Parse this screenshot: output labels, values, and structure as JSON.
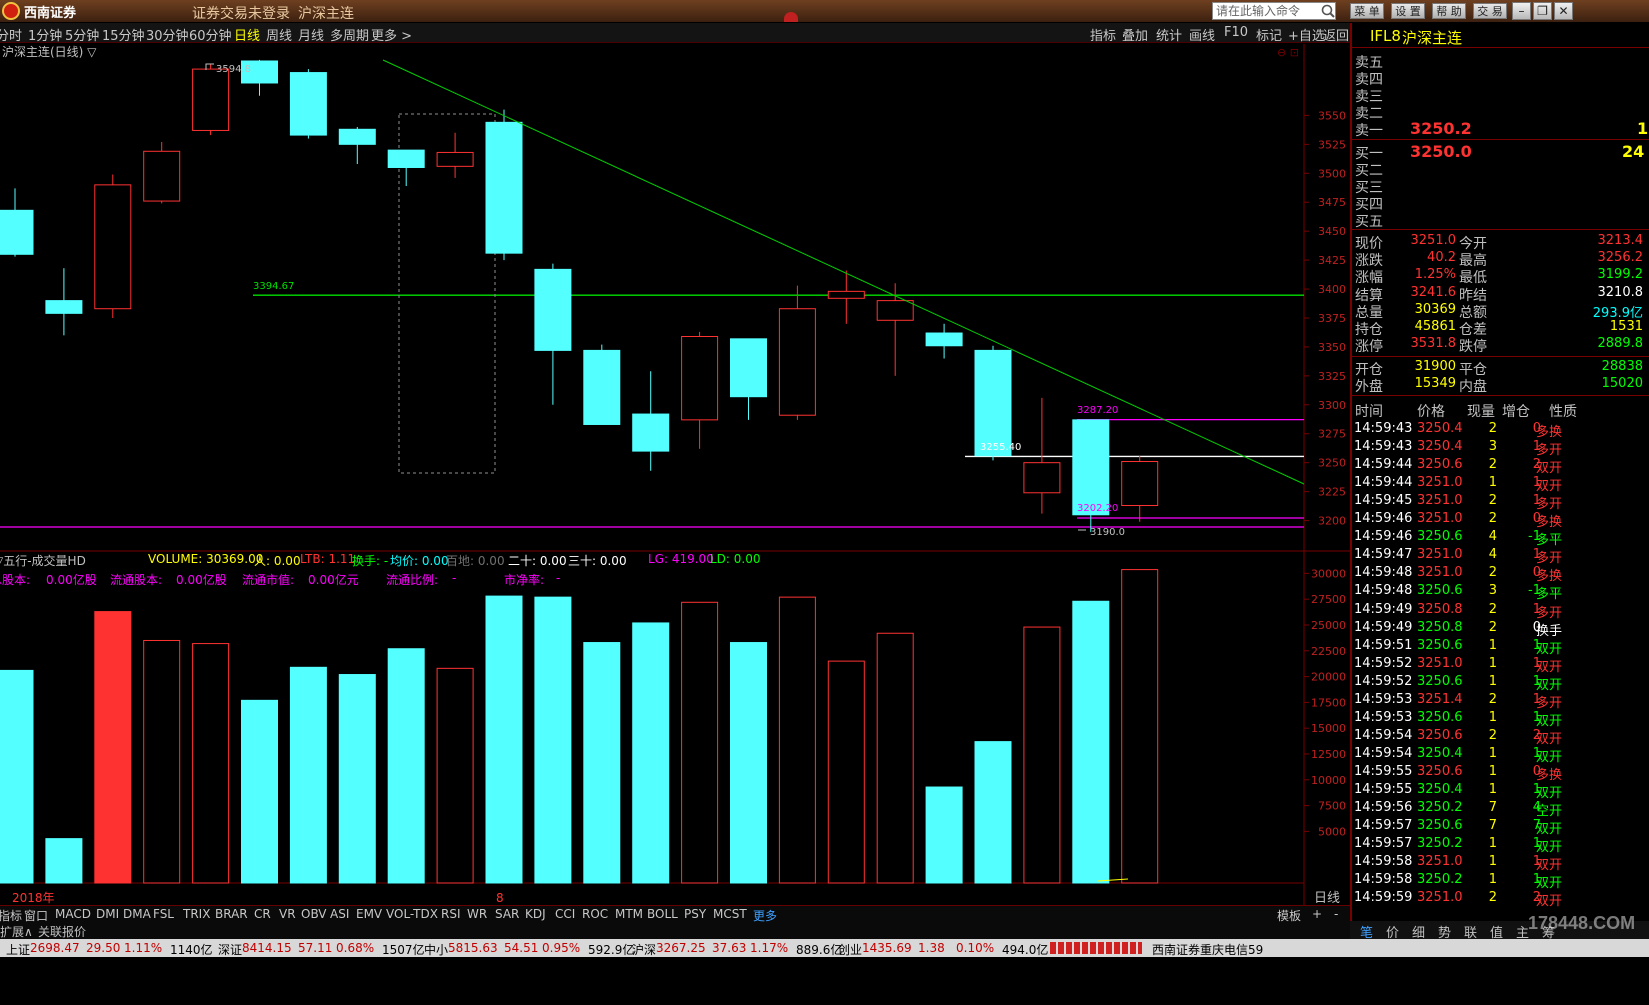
{
  "window": {
    "brand": "西南证券",
    "login_status": "证券交易未登录",
    "instrument_title": "沪深主连",
    "command_placeholder": "请在此输入命令",
    "buttons": [
      "菜 单",
      "设 置",
      "帮 助",
      "交 易"
    ]
  },
  "period_bar": {
    "periods": [
      "分时",
      "1分钟",
      "5分钟",
      "15分钟",
      "30分钟",
      "60分钟",
      "日线",
      "周线",
      "月线",
      "多周期",
      "更多 >"
    ],
    "active": "日线",
    "tools": [
      "指标",
      "叠加",
      "统计",
      "画线",
      "F10",
      "标记",
      "+自选",
      "返回"
    ]
  },
  "main_chart": {
    "label": "沪深主连(日线) ▽",
    "price_axis": [
      "3550",
      "3525",
      "3500",
      "3475",
      "3450",
      "3425",
      "3400",
      "3375",
      "3350",
      "3325",
      "3300",
      "3275",
      "3250",
      "3225",
      "3200"
    ],
    "annotations": {
      "high": "3594.8",
      "low": "3190.0",
      "hline_green": "3394.67",
      "hline_white": "3255.40",
      "hline_magenta_top": "3287.20",
      "hline_magenta_bottom": "3202.20"
    },
    "colors": {
      "up": "#ff3232",
      "down": "#54ffff",
      "trendline": "#00e000",
      "magenta": "#ff00ff",
      "white": "#ffffff"
    }
  },
  "chart_data": [
    {
      "type": "candlestick",
      "title": "沪深主连(日线)",
      "candles": [
        {
          "open": 3468,
          "close": 3430,
          "high": 3487,
          "low": 3428
        },
        {
          "open": 3390,
          "close": 3379,
          "high": 3418,
          "low": 3360
        },
        {
          "open": 3383,
          "close": 3490,
          "high": 3499,
          "low": 3375
        },
        {
          "open": 3476,
          "close": 3519,
          "high": 3527,
          "low": 3474
        },
        {
          "open": 3537,
          "close": 3590,
          "high": 3594.8,
          "low": 3533
        },
        {
          "open": 3597,
          "close": 3578,
          "high": 3598,
          "low": 3567
        },
        {
          "open": 3587,
          "close": 3533,
          "high": 3590,
          "low": 3530
        },
        {
          "open": 3538,
          "close": 3525,
          "high": 3540,
          "low": 3508
        },
        {
          "open": 3520,
          "close": 3505,
          "high": 3520,
          "low": 3489
        },
        {
          "open": 3506,
          "close": 3518,
          "high": 3535,
          "low": 3496
        },
        {
          "open": 3544,
          "close": 3431,
          "high": 3555,
          "low": 3425
        },
        {
          "open": 3417,
          "close": 3347,
          "high": 3422,
          "low": 3300
        },
        {
          "open": 3347,
          "close": 3283,
          "high": 3352,
          "low": 3283
        },
        {
          "open": 3292,
          "close": 3260,
          "high": 3329,
          "low": 3243
        },
        {
          "open": 3287,
          "close": 3359,
          "high": 3363,
          "low": 3262
        },
        {
          "open": 3357,
          "close": 3307,
          "high": 3357,
          "low": 3287
        },
        {
          "open": 3291,
          "close": 3383,
          "high": 3403,
          "low": 3287
        },
        {
          "open": 3392,
          "close": 3398,
          "high": 3416,
          "low": 3370
        },
        {
          "open": 3373,
          "close": 3390,
          "high": 3405,
          "low": 3325
        },
        {
          "open": 3362,
          "close": 3351,
          "high": 3370,
          "low": 3340
        },
        {
          "open": 3347,
          "close": 3256,
          "high": 3351,
          "low": 3252
        },
        {
          "open": 3224,
          "close": 3250,
          "high": 3306,
          "low": 3206
        },
        {
          "open": 3287,
          "close": 3205,
          "high": 3287.2,
          "low": 3190.0
        },
        {
          "open": 3213,
          "close": 3251,
          "high": 3256,
          "low": 3199
        }
      ]
    },
    {
      "type": "bar",
      "title": "五行-成交量HD",
      "ylim": [
        0,
        31000
      ],
      "y_ticks": [
        "30000",
        "27500",
        "25000",
        "22500",
        "20000",
        "17500",
        "15000",
        "12500",
        "10000",
        "7500",
        "5000"
      ],
      "values": [
        20600,
        4300,
        26300,
        23500,
        23200,
        17700,
        20900,
        20200,
        22700,
        20800,
        27800,
        27700,
        23300,
        25200,
        27200,
        23300,
        27700,
        21500,
        24200,
        9300,
        13700,
        24800,
        27300,
        30369
      ],
      "bar_colors": [
        "c",
        "c",
        "r",
        "r",
        "r",
        "c",
        "c",
        "c",
        "c",
        "r",
        "c",
        "c",
        "c",
        "c",
        "r",
        "c",
        "r",
        "r",
        "r",
        "c",
        "c",
        "r",
        "c",
        "r"
      ]
    }
  ],
  "vol_header": {
    "items": [
      {
        "text": "▽五行-成交量HD",
        "color": "#c0c0c0"
      },
      {
        "text": "VOLUME: 30369.00",
        "color": "#ffff00"
      },
      {
        "text": "人: 0.00",
        "color": "#ffff00"
      },
      {
        "text": "LTB: 1.11",
        "color": "#ff3232"
      },
      {
        "text": "换手: -",
        "color": "#00ff00"
      },
      {
        "text": "均价: 0.00",
        "color": "#00ffff"
      },
      {
        "text": "百地: 0.00",
        "color": "#707070"
      },
      {
        "text": "二十: 0.00",
        "color": "#ffffff"
      },
      {
        "text": "三十: 0.00",
        "color": "#ffffff"
      },
      {
        "text": "LG: 419.00",
        "color": "#ff00ff"
      },
      {
        "text": "LD: 0.00",
        "color": "#00ff00"
      }
    ],
    "row2": [
      {
        "text": "总股本:",
        "color": "#ff00ff"
      },
      {
        "text": "0.00亿股",
        "color": "#ff00ff"
      },
      {
        "text": "流通股本:",
        "color": "#ff00ff"
      },
      {
        "text": "0.00亿股",
        "color": "#ff00ff"
      },
      {
        "text": "流通市值:",
        "color": "#ff00ff"
      },
      {
        "text": "0.00亿元",
        "color": "#ff00ff"
      },
      {
        "text": "流通比例:",
        "color": "#ff00ff"
      },
      {
        "text": "-",
        "color": "#ff00ff"
      },
      {
        "text": "市净率:",
        "color": "#ff00ff"
      },
      {
        "text": "-",
        "color": "#ff00ff"
      }
    ]
  },
  "x_axis": {
    "year_label": "2018年",
    "month_label": "8",
    "period_label": "日线"
  },
  "indicator_tabs": [
    "指标",
    "窗口",
    "MACD",
    "DMI",
    "DMA",
    "FSL",
    "TRIX",
    "BRAR",
    "CR",
    "VR",
    "OBV",
    "ASI",
    "EMV",
    "VOL-TDX",
    "RSI",
    "WR",
    "SAR",
    "KDJ",
    "CCI",
    "ROC",
    "MTM",
    "BOLL",
    "PSY",
    "MCST",
    "更多"
  ],
  "indicator_right": [
    "模板",
    "+",
    "-"
  ],
  "expand_bar": [
    "扩展∧",
    "关联报价"
  ],
  "quote_panel": {
    "code": "IFL8",
    "name": "沪深主连",
    "sell_labels": [
      "卖五",
      "卖四",
      "卖三",
      "卖二",
      "卖一"
    ],
    "sell1_price": "3250.2",
    "sell1_vol": "1",
    "buy_labels": [
      "买一",
      "买二",
      "买三",
      "买四",
      "买五"
    ],
    "buy1_price": "3250.0",
    "buy1_vol": "24",
    "stats": [
      {
        "l1": "现价",
        "v1": "3251.0",
        "c1": "#ff3232",
        "l2": "今开",
        "v2": "3213.4",
        "c2": "#ff3232"
      },
      {
        "l1": "涨跌",
        "v1": "40.2",
        "c1": "#ff3232",
        "l2": "最高",
        "v2": "3256.2",
        "c2": "#ff3232"
      },
      {
        "l1": "涨幅",
        "v1": "1.25%",
        "c1": "#ff3232",
        "l2": "最低",
        "v2": "3199.2",
        "c2": "#00ff00"
      },
      {
        "l1": "结算",
        "v1": "3241.6",
        "c1": "#ff3232",
        "l2": "昨结",
        "v2": "3210.8",
        "c2": "#ffffff"
      },
      {
        "l1": "总量",
        "v1": "30369",
        "c1": "#ffff00",
        "l2": "总额",
        "v2": "293.9亿",
        "c2": "#00ffff"
      },
      {
        "l1": "持仓",
        "v1": "45861",
        "c1": "#ffff00",
        "l2": "仓差",
        "v2": "1531",
        "c2": "#ffff00"
      },
      {
        "l1": "涨停",
        "v1": "3531.8",
        "c1": "#ff3232",
        "l2": "跌停",
        "v2": "2889.8",
        "c2": "#00ff00"
      }
    ],
    "openclose": [
      {
        "l1": "开仓",
        "v1": "31900",
        "l2": "平仓",
        "v2": "28838"
      },
      {
        "l1": "外盘",
        "v1": "15349",
        "l2": "内盘",
        "v2": "15020"
      }
    ],
    "tick_headers": [
      "时间",
      "价格",
      "现量",
      "增仓",
      "性质"
    ],
    "ticks": [
      {
        "t": "14:59:43",
        "p": "3250.4",
        "v": "2",
        "d": "0",
        "n": "多换",
        "c": "r"
      },
      {
        "t": "14:59:43",
        "p": "3250.4",
        "v": "3",
        "d": "1",
        "n": "多开",
        "c": "r"
      },
      {
        "t": "14:59:44",
        "p": "3250.6",
        "v": "2",
        "d": "2",
        "n": "双开",
        "c": "r"
      },
      {
        "t": "14:59:44",
        "p": "3251.0",
        "v": "1",
        "d": "1",
        "n": "双开",
        "c": "r"
      },
      {
        "t": "14:59:45",
        "p": "3251.0",
        "v": "2",
        "d": "1",
        "n": "多开",
        "c": "r"
      },
      {
        "t": "14:59:46",
        "p": "3251.0",
        "v": "2",
        "d": "0",
        "n": "多换",
        "c": "r"
      },
      {
        "t": "14:59:46",
        "p": "3250.6",
        "v": "4",
        "d": "-1",
        "n": "多平",
        "c": "g"
      },
      {
        "t": "14:59:47",
        "p": "3251.0",
        "v": "4",
        "d": "1",
        "n": "多开",
        "c": "r"
      },
      {
        "t": "14:59:48",
        "p": "3251.0",
        "v": "2",
        "d": "0",
        "n": "多换",
        "c": "r"
      },
      {
        "t": "14:59:48",
        "p": "3250.6",
        "v": "3",
        "d": "-1",
        "n": "多平",
        "c": "g"
      },
      {
        "t": "14:59:49",
        "p": "3250.8",
        "v": "2",
        "d": "1",
        "n": "多开",
        "c": "r"
      },
      {
        "t": "14:59:49",
        "p": "3250.8",
        "v": "2",
        "d": "0",
        "n": "换手",
        "c": "w"
      },
      {
        "t": "14:59:51",
        "p": "3250.6",
        "v": "1",
        "d": "1",
        "n": "双开",
        "c": "g"
      },
      {
        "t": "14:59:52",
        "p": "3251.0",
        "v": "1",
        "d": "1",
        "n": "双开",
        "c": "r"
      },
      {
        "t": "14:59:52",
        "p": "3250.6",
        "v": "1",
        "d": "1",
        "n": "双开",
        "c": "g"
      },
      {
        "t": "14:59:53",
        "p": "3251.4",
        "v": "2",
        "d": "1",
        "n": "多开",
        "c": "r"
      },
      {
        "t": "14:59:53",
        "p": "3250.6",
        "v": "1",
        "d": "1",
        "n": "双开",
        "c": "g"
      },
      {
        "t": "14:59:54",
        "p": "3250.6",
        "v": "2",
        "d": "2",
        "n": "双开",
        "c": "r"
      },
      {
        "t": "14:59:54",
        "p": "3250.4",
        "v": "1",
        "d": "1",
        "n": "双开",
        "c": "g"
      },
      {
        "t": "14:59:55",
        "p": "3250.6",
        "v": "1",
        "d": "0",
        "n": "多换",
        "c": "r"
      },
      {
        "t": "14:59:55",
        "p": "3250.4",
        "v": "1",
        "d": "1",
        "n": "双开",
        "c": "g"
      },
      {
        "t": "14:59:56",
        "p": "3250.2",
        "v": "7",
        "d": "4",
        "n": "空开",
        "c": "g"
      },
      {
        "t": "14:59:57",
        "p": "3250.6",
        "v": "7",
        "d": "7",
        "n": "双开",
        "c": "g"
      },
      {
        "t": "14:59:57",
        "p": "3250.2",
        "v": "1",
        "d": "1",
        "n": "双开",
        "c": "g"
      },
      {
        "t": "14:59:58",
        "p": "3251.0",
        "v": "1",
        "d": "1",
        "n": "双开",
        "c": "r"
      },
      {
        "t": "14:59:58",
        "p": "3250.2",
        "v": "1",
        "d": "1",
        "n": "双开",
        "c": "g"
      },
      {
        "t": "14:59:59",
        "p": "3251.0",
        "v": "2",
        "d": "2",
        "n": "双开",
        "c": "r"
      }
    ],
    "bottom_tabs": [
      "笔",
      "价",
      "细",
      "势",
      "联",
      "值",
      "主",
      "筹"
    ]
  },
  "status_bar": [
    {
      "name": "上证",
      "price": "2698.47",
      "chg": "29.50",
      "pct": "1.11%",
      "amt": "1140亿"
    },
    {
      "name": "深证",
      "price": "8414.15",
      "chg": "57.11",
      "pct": "0.68%",
      "amt": "1507亿"
    },
    {
      "name": "中小",
      "price": "5815.63",
      "chg": "54.51",
      "pct": "0.95%",
      "amt": "592.9亿"
    },
    {
      "name": "沪深",
      "price": "3267.25",
      "chg": "37.63",
      "pct": "1.17%",
      "amt": "889.6亿"
    },
    {
      "name": "创业",
      "price": "1435.69",
      "chg": "1.38",
      "pct": "0.10%",
      "amt": "494.0亿"
    }
  ],
  "broker_server": "西南证券重庆电信59",
  "watermark": "178448.COM"
}
